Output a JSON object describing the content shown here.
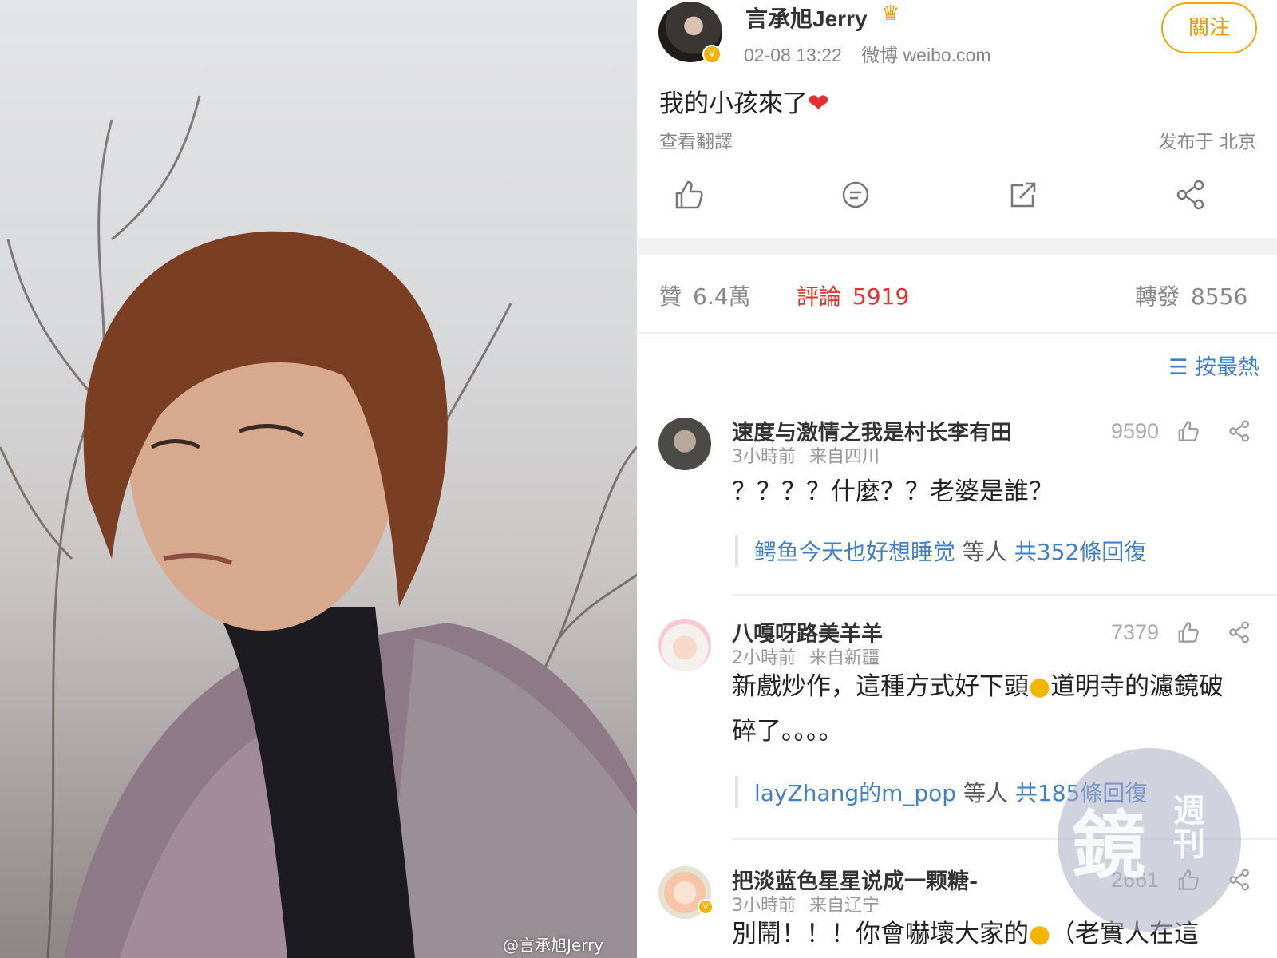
{
  "photo": {
    "watermark": "@言承旭Jerry"
  },
  "post": {
    "author_name": "言承旭Jerry",
    "timestamp": "02-08 13:22",
    "source": "微博 weibo.com",
    "follow_label": "關注",
    "text": "我的小孩來了",
    "translate_label": "查看翻譯",
    "location": "发布于 北京"
  },
  "actions": {
    "icons": [
      "like-icon",
      "comment-icon",
      "repost-icon",
      "share-icon"
    ]
  },
  "stats": {
    "likes_label": "贊",
    "likes_value": "6.4萬",
    "comments_label": "評論",
    "comments_value": "5919",
    "reposts_label": "轉發",
    "reposts_value": "8556",
    "active_color": "#e5322d"
  },
  "sort": {
    "icon": "sort-icon",
    "label": "按最熱"
  },
  "comments": [
    {
      "name": "速度与激情之我是村长李有田",
      "time": "3小時前",
      "from": "来自四川",
      "likes": "9590",
      "text": "？？？？什麼？？老婆是誰？",
      "reply_users": "鳄鱼今天也好想睡觉",
      "reply_mid": " 等人 ",
      "reply_count": "共352條回復"
    },
    {
      "name": "八嘎呀路美羊羊",
      "time": "2小時前",
      "from": "来自新疆",
      "likes": "7379",
      "text": "新戲炒作，這種方式好下頭",
      "text_after_emoji": "道明寺的濾鏡破碎了。。。。",
      "reply_users": "layZhang的m_pop",
      "reply_mid": " 等人 ",
      "reply_count": "共185條回復"
    },
    {
      "name": "把淡蓝色星星说成一颗糖-",
      "time": "3小時前",
      "from": "来自辽宁",
      "likes": "2661",
      "text": "別鬧！！！你會嚇壞大家的",
      "text_after_emoji": "（老實人在這"
    }
  ],
  "overlay": {
    "logo_char": "鏡",
    "logo_side": "週刊"
  }
}
